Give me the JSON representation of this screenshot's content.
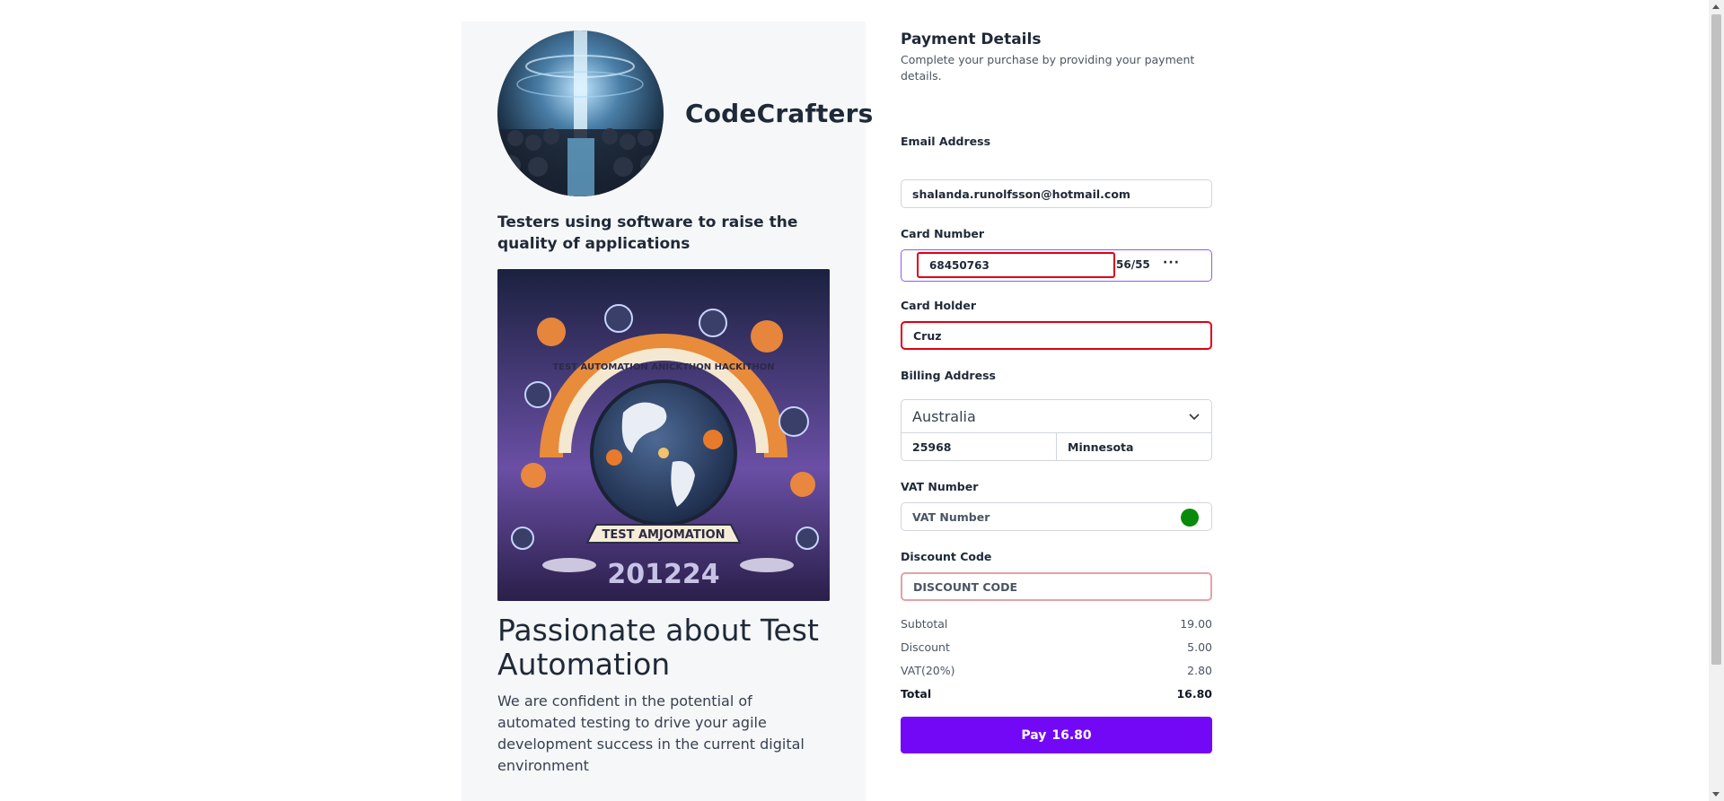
{
  "brand": {
    "name": "CodeCrafters",
    "tagline": "Testers using software to raise the quality of applications"
  },
  "poster": {
    "banner_text": "TEST AUTOMATION ANICKTHON HACKITHON",
    "ribbon_text": "TEST AMJOMATION",
    "year_text": "201224"
  },
  "hero": {
    "headline": "Passionate about Test Automation",
    "body": "We are confident in the potential of automated testing to drive your agile development success in the current digital environment"
  },
  "form": {
    "title": "Payment Details",
    "subtitle": "Complete your purchase by providing your payment details.",
    "email": {
      "label": "Email Address",
      "value": "shalanda.runolfsson@hotmail.com"
    },
    "card": {
      "label": "Card Number",
      "number": "68450763",
      "expiry": "56/55",
      "cvc": "···"
    },
    "holder": {
      "label": "Card Holder",
      "value": "Cruz"
    },
    "billing": {
      "label": "Billing Address",
      "country": "Australia",
      "zip": "25968",
      "state": "Minnesota"
    },
    "vat": {
      "label": "VAT Number",
      "placeholder": "VAT Number"
    },
    "discount": {
      "label": "Discount Code",
      "placeholder": "DISCOUNT CODE"
    }
  },
  "summary": {
    "subtotal_label": "Subtotal",
    "subtotal": "19.00",
    "discount_label": "Discount",
    "discount": "5.00",
    "vat_label": "VAT(20%)",
    "vat": "2.80",
    "total_label": "Total",
    "total": "16.80"
  },
  "pay_button": {
    "label": "Pay",
    "amount": "16.80"
  },
  "colors": {
    "accent": "#7308f7",
    "error": "#e00012",
    "success": "#0a8a0a",
    "focus": "#8b5cf6"
  }
}
